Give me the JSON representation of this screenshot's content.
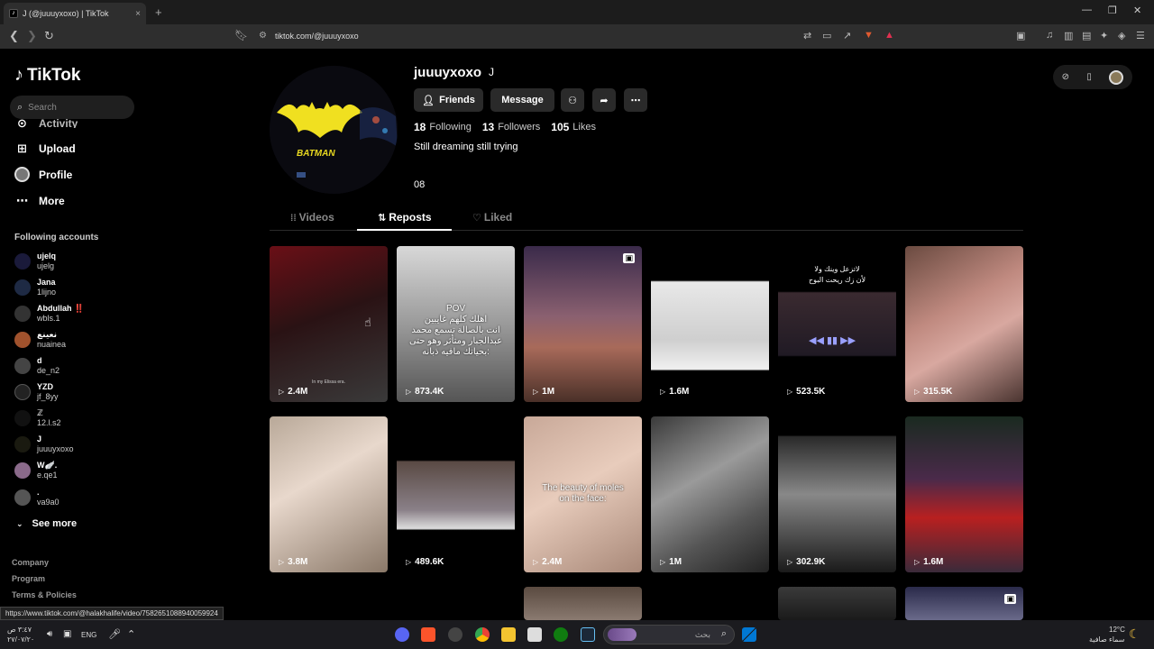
{
  "browser": {
    "tab_title": "J (@juuuyxoxo) | TikTok",
    "tab_close": "×",
    "new_tab": "+",
    "url": "tiktok.com/@juuuyxoxo",
    "status_url": "https://www.tiktok.com/@halakhalife/video/7582651088940059924"
  },
  "sidebar": {
    "logo": "TikTok",
    "search_placeholder": "Search",
    "activity_partial": "Activity",
    "nav": [
      {
        "label": "Upload"
      },
      {
        "label": "Profile"
      },
      {
        "label": "More"
      }
    ],
    "following_header": "Following accounts",
    "accounts": [
      {
        "name": "ujelq",
        "handle": "ujelg",
        "color": "#1a1a3a"
      },
      {
        "name": "Jana",
        "handle": "1lijno",
        "color": "#1e2a44"
      },
      {
        "name": "Abdullah ‼️",
        "handle": "wbls.1",
        "color": "#333"
      },
      {
        "name": "نعينع",
        "handle": "nuainea",
        "color": "#a0522d"
      },
      {
        "name": "d",
        "handle": "de_n2",
        "color": "#444"
      },
      {
        "name": "YZD",
        "handle": "jf_8yy",
        "color": "#222"
      },
      {
        "name": "ℤ",
        "handle": "12.l.s2",
        "color": "#111"
      },
      {
        "name": "J",
        "handle": "juuuyxoxo",
        "color": "#1a1a10"
      },
      {
        "name": "W🪽.",
        "handle": "e.qe1",
        "color": "#8a6a8a"
      },
      {
        "name": ".",
        "handle": "va9a0",
        "color": "#555"
      }
    ],
    "see_more": "See more",
    "footer": [
      "Company",
      "Program",
      "Terms & Policies"
    ]
  },
  "profile": {
    "username": "juuuyxoxo",
    "nickname": "J",
    "buttons": {
      "friends": "Friends",
      "message": "Message"
    },
    "following_count": "18",
    "following_label": "Following",
    "followers_count": "13",
    "followers_label": "Followers",
    "likes_count": "105",
    "likes_label": "Likes",
    "bio": "Still dreaming still trying",
    "link": "08",
    "pic_text": "BATMAN"
  },
  "tabs": [
    {
      "label": "Videos",
      "icon": "grid-icon"
    },
    {
      "label": "Reposts",
      "icon": "repost-icon"
    },
    {
      "label": "Liked",
      "icon": "heart-icon"
    }
  ],
  "videos": [
    {
      "views": "2.4M",
      "bg": "linear-gradient(160deg,#6a0f16 0%,#2a1214 45%,#3a3a3a 100%)",
      "caption": "In my Elissa era."
    },
    {
      "views": "873.4K",
      "bg": "linear-gradient(180deg,#d8d8d8 0%,#9a9a9a 50%,#555 100%)",
      "caption": "POV\nاهلك كلهم غايبين\nانت بالصالة تسمع محمد\nعبدالجبار ومتأثر وهو حتى\nبحياتك مافيه ذبانه:"
    },
    {
      "views": "1M",
      "bg": "linear-gradient(180deg,#3a2a4a 0%,#8a6070 45%,#a86a5a 65%,#4a3028 100%)",
      "caption": ""
    },
    {
      "views": "1.6M",
      "bg": "linear-gradient(180deg,#000 0%,#000 22%,#e8e8e8 23%,#cfcfcf 60%,#f0f0f0 79%,#000 80%)",
      "caption": ""
    },
    {
      "views": "523.5K",
      "bg": "linear-gradient(180deg,#000 0%,#000 29%,#3a2a30 30%,#201a24 70%,#000 71%)",
      "caption": "لاتزعل وينك ولا\nلأن زك  ريحت البوح"
    },
    {
      "views": "315.5K",
      "bg": "linear-gradient(150deg,#6a4a40 0%,#c08a80 40%,#d8a8a0 60%,#4a3430 100%)",
      "caption": ""
    },
    {
      "views": "3.8M",
      "bg": "linear-gradient(150deg,#b8a898 0%,#e8d8cc 40%,#8a7868 100%)",
      "caption": ""
    },
    {
      "views": "489.6K",
      "bg": "linear-gradient(180deg,#000 0%,#000 28%,#5a4a44 29%,#8a8088 60%,#ddd 72%,#000 73%)",
      "caption": ""
    },
    {
      "views": "2.4M",
      "bg": "linear-gradient(150deg,#c8a898 0%,#e8ccbc 45%,#a88878 100%)",
      "caption": "The beauty of moles\non the face:"
    },
    {
      "views": "1M",
      "bg": "linear-gradient(150deg,#3a3a3a 0%,#9a9a9a 40%,#555 70%,#222 100%)",
      "caption": ""
    },
    {
      "views": "302.9K",
      "bg": "linear-gradient(180deg,#000 0%,#000 12%,#2a2a2a 13%,#888 50%,#1a1a1a 100%)",
      "caption": ""
    },
    {
      "views": "1.6M",
      "bg": "linear-gradient(180deg,#1a2a20 0%,#4a2a4a 40%,#b82020 65%,#3a2a3a 100%)",
      "caption": ""
    }
  ],
  "taskbar": {
    "search_placeholder": "بحث",
    "weather_temp": "12°C",
    "weather_desc": "سماء صافية",
    "lang": "ENG",
    "time": "٣:٤٧ ص",
    "date": "٢٧/٠٧/٢٠"
  }
}
